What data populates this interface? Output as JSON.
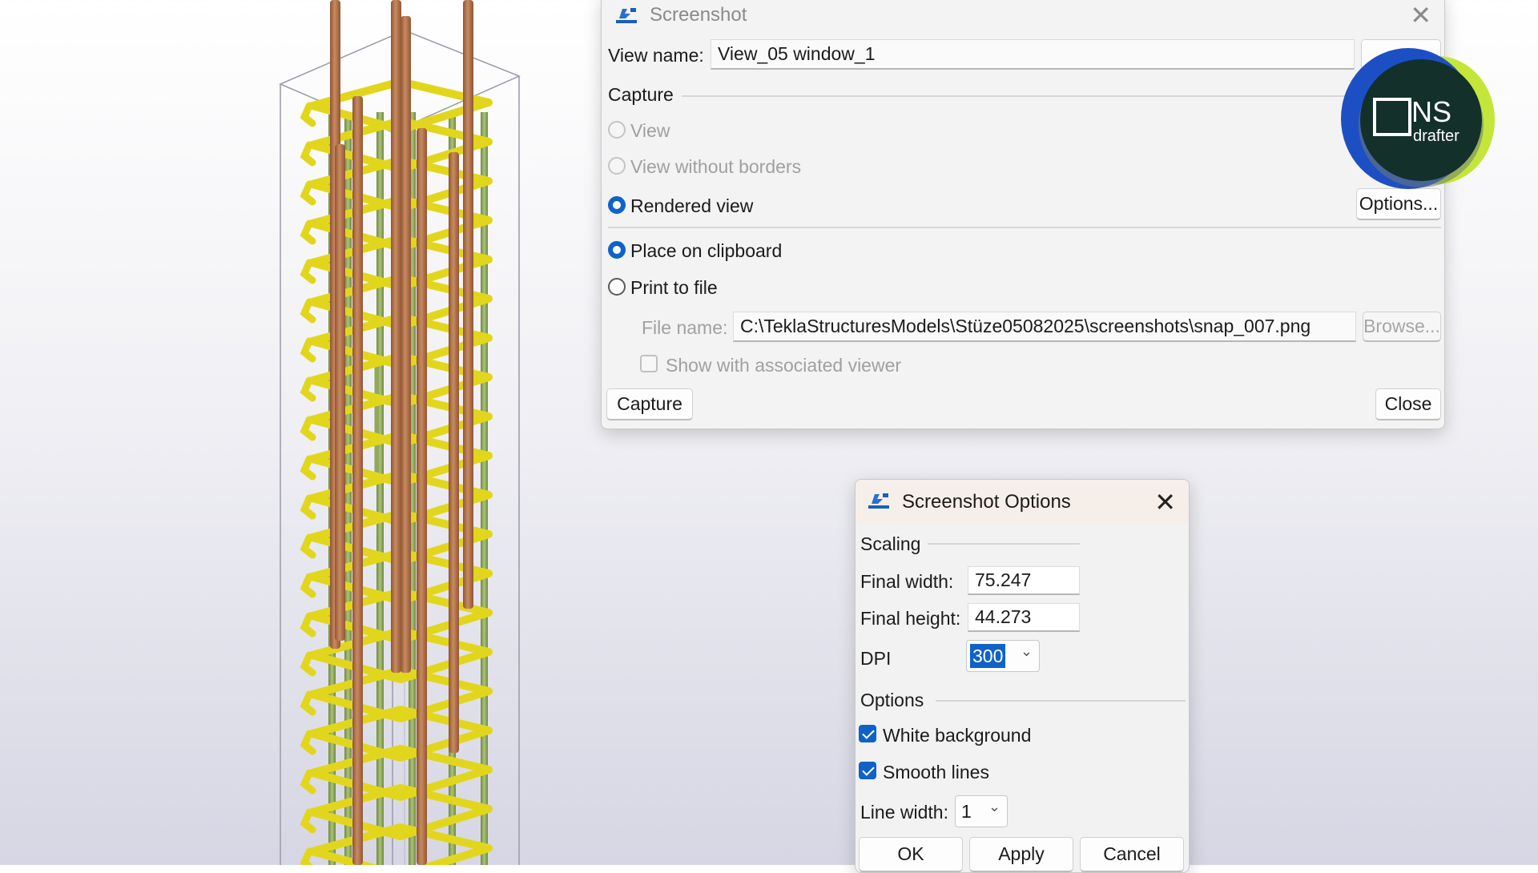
{
  "colors": {
    "accent": "#0f62c8",
    "stirrup": "#e2d61c",
    "rebar_main": "#b9734a",
    "rebar_inner": "#8fa85a",
    "logo_dark": "#13302a",
    "logo_blue": "#1d4fc4",
    "logo_lime": "#c4e63a"
  },
  "screenshot_dialog": {
    "title": "Screenshot",
    "app_icon": "tekla-screenshot-icon",
    "close_icon": "close-icon",
    "view_name_label": "View name:",
    "view_name_value": "View_05 window_1",
    "capture_group_label": "Capture",
    "capture_options": [
      {
        "label": "View",
        "enabled": false,
        "selected": false
      },
      {
        "label": "View without borders",
        "enabled": false,
        "selected": false
      },
      {
        "label": "Rendered view",
        "enabled": true,
        "selected": true
      }
    ],
    "options_button": "Options...",
    "output_options": [
      {
        "label": "Place on clipboard",
        "selected": true
      },
      {
        "label": "Print to file",
        "selected": false
      }
    ],
    "file_name_label": "File name:",
    "file_name_value": "C:\\TeklaStructuresModels\\Stüze05082025\\screenshots\\snap_007.png",
    "browse_button": "Browse...",
    "show_viewer_label": "Show with associated viewer",
    "capture_button": "Capture",
    "close_button": "Close"
  },
  "options_dialog": {
    "title": "Screenshot Options",
    "app_icon": "tekla-screenshot-icon",
    "close_icon": "close-icon",
    "scaling_label": "Scaling",
    "final_width_label": "Final width:",
    "final_width_value": "75.247",
    "final_height_label": "Final height:",
    "final_height_value": "44.273",
    "dpi_label": "DPI",
    "dpi_value": "300",
    "options_label": "Options",
    "checkboxes": [
      {
        "label": "White background",
        "checked": true
      },
      {
        "label": "Smooth lines",
        "checked": true
      }
    ],
    "line_width_label": "Line width:",
    "line_width_value": "1",
    "ok_button": "OK",
    "apply_button": "Apply",
    "cancel_button": "Cancel"
  },
  "logo": {
    "text_main": "NS",
    "text_sub": "drafter",
    "icon": "ns-drafter-logo"
  }
}
